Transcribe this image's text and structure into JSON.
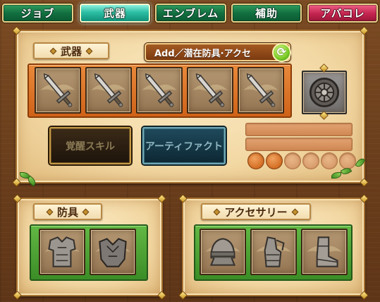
{
  "tabs": [
    {
      "label": "ジョブ",
      "active": false
    },
    {
      "label": "武器",
      "active": true
    },
    {
      "label": "エンブレム",
      "active": false
    },
    {
      "label": "補助",
      "active": false
    },
    {
      "label": "アバコレ",
      "active": false
    }
  ],
  "weapon_panel": {
    "title": "武器",
    "add_button_label": "Add／潜在防具·アクセ",
    "awaken_skill_label": "覚醒スキル",
    "artifact_label": "アーティファクト",
    "weapon_slots": [
      "sword",
      "sword",
      "sword",
      "sword",
      "sword"
    ],
    "special_slot_icon": "shield-emblem",
    "progress_bars": 2,
    "dots_total": 6,
    "dots_filled": 2
  },
  "armor_panel": {
    "title": "防具",
    "slots": [
      "body-armor",
      "cloak-armor"
    ]
  },
  "accessory_panel": {
    "title": "アクセサリー",
    "slots": [
      "helmet",
      "gauntlet",
      "boots"
    ]
  },
  "colors": {
    "tab_green": "#127040",
    "tab_active": "#2cbfa4",
    "tab_pink": "#c3244f",
    "parchment": "#f2d7a2",
    "orange_strip": "#cf6218",
    "green_strip": "#3b8d26"
  }
}
